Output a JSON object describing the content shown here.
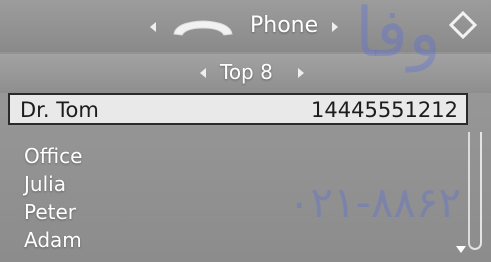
{
  "header": {
    "title": "Phone",
    "icon": "handset-icon"
  },
  "subheader": {
    "title": "Top 8"
  },
  "selected": {
    "name": "Dr. Tom",
    "number": "14445551212"
  },
  "contacts": [
    "Office",
    "Julia",
    "Peter",
    "Adam"
  ],
  "watermark": {
    "top": "وفا",
    "bottom": "۰۲۱-۸۸۶۲"
  },
  "colors": {
    "background": "#8e8e8e",
    "selected_bg": "#e9e9e9",
    "text": "#ffffff"
  }
}
